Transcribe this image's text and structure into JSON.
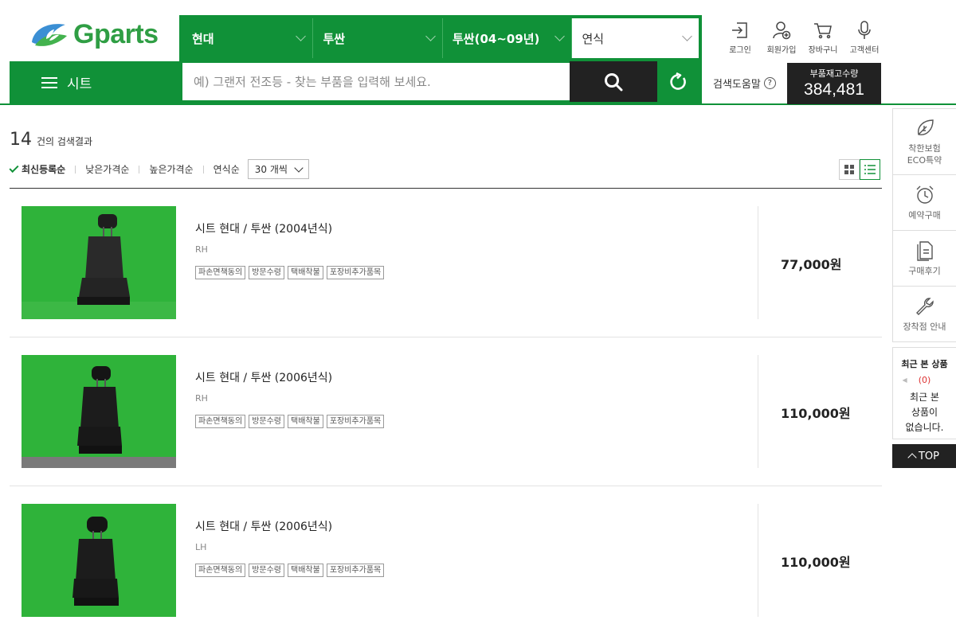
{
  "brand": {
    "logo_text": "Gparts",
    "green": "#109138"
  },
  "filters": [
    {
      "label": "현대"
    },
    {
      "label": "투싼"
    },
    {
      "label": "투싼(04~09년)"
    },
    {
      "label": "연식"
    }
  ],
  "top_icons": [
    {
      "label": "로그인",
      "icon": "login-icon"
    },
    {
      "label": "회원가입",
      "icon": "user-add-icon"
    },
    {
      "label": "장바구니",
      "icon": "cart-icon"
    },
    {
      "label": "고객센터",
      "icon": "mic-icon"
    }
  ],
  "nav": {
    "menu_label": "시트",
    "search_placeholder": "예) 그랜저 전조등 - 찾는 부품을 입력해 보세요.",
    "help_label": "검색도움말",
    "stock_label": "부품재고수량",
    "stock_value": "384,481"
  },
  "results": {
    "count": "14",
    "count_label": "건의 검색결과",
    "sort": [
      "최신등록순",
      "낮은가격순",
      "높은가격순",
      "연식순"
    ],
    "per_page": "30 개씩"
  },
  "products": [
    {
      "title": "시트 현대 / 투싼 (2004년식)",
      "side": "RH",
      "price": "77,000원",
      "tags": [
        "파손면책동의",
        "방문수령",
        "택배착불",
        "포장비추가품목"
      ]
    },
    {
      "title": "시트 현대 / 투싼 (2006년식)",
      "side": "RH",
      "price": "110,000원",
      "tags": [
        "파손면책동의",
        "방문수령",
        "택배착불",
        "포장비추가품목"
      ]
    },
    {
      "title": "시트 현대 / 투싼 (2006년식)",
      "side": "LH",
      "price": "110,000원",
      "tags": [
        "파손면책동의",
        "방문수령",
        "택배착불",
        "포장비추가품목"
      ]
    }
  ],
  "sidebar": {
    "items": [
      {
        "label_line1": "착한보험",
        "label_line2": "ECO특약",
        "icon": "leaf-icon"
      },
      {
        "label_line1": "예약구매",
        "icon": "alarm-clock-icon"
      },
      {
        "label_line1": "구매후기",
        "icon": "document-icon"
      },
      {
        "label_line1": "장착점 안내",
        "icon": "wrench-icon"
      }
    ],
    "recent_title": "최근 본 상품",
    "recent_count": "(0)",
    "recent_empty_1": "최근 본",
    "recent_empty_2": "상품이",
    "recent_empty_3": "없습니다.",
    "top_label": "TOP"
  }
}
